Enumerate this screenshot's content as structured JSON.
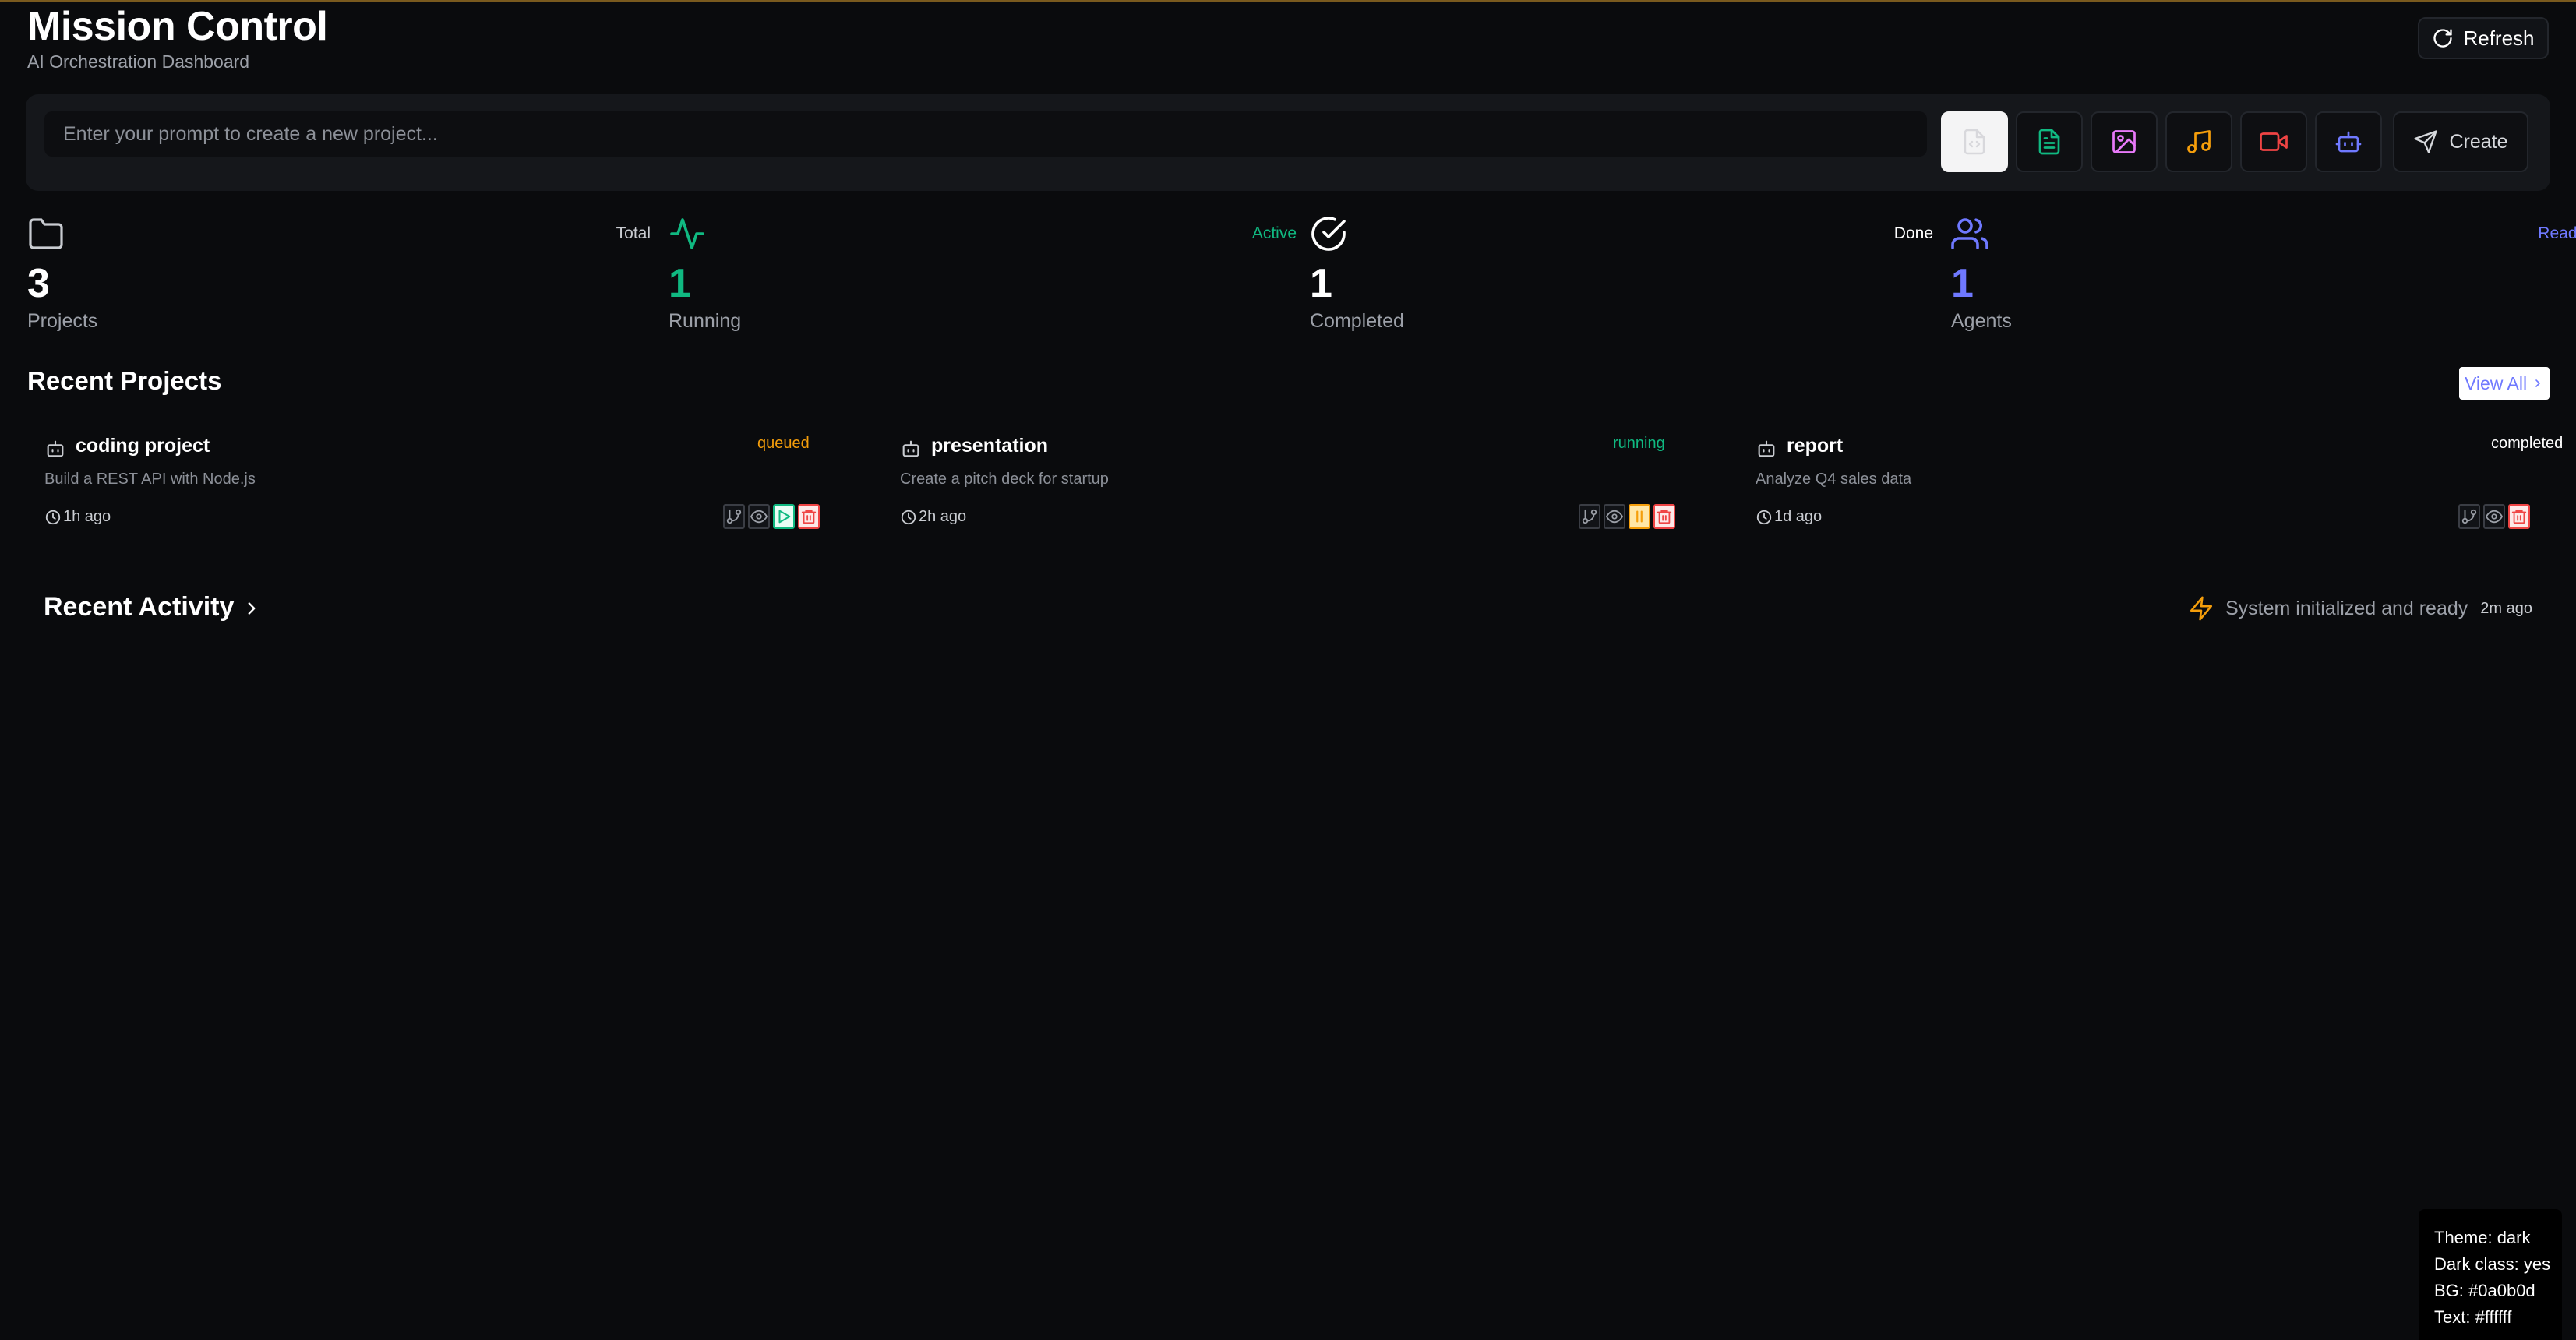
{
  "header": {
    "title": "Mission Control",
    "subtitle": "AI Orchestration Dashboard",
    "refresh_label": "Refresh"
  },
  "prompt": {
    "placeholder": "Enter your prompt to create a new project...",
    "value": "",
    "create_label": "Create",
    "tools": [
      "document",
      "spreadsheet",
      "image",
      "audio",
      "video",
      "agent"
    ],
    "selected_tool": "document"
  },
  "stats": [
    {
      "value": "3",
      "label": "Projects",
      "tag": "Total",
      "icon": "folder-icon",
      "value_color": "#ffffff",
      "tag_color": "#c9ccd1"
    },
    {
      "value": "1",
      "label": "Running",
      "tag": "Active",
      "icon": "activity-icon",
      "value_color": "#10b981",
      "tag_color": "#10b981"
    },
    {
      "value": "1",
      "label": "Completed",
      "tag": "Done",
      "icon": "check-circle-icon",
      "value_color": "#ffffff",
      "tag_color": "#ffffff"
    },
    {
      "value": "1",
      "label": "Agents",
      "tag": "Ready",
      "icon": "users-icon",
      "value_color": "#6f79ff",
      "tag_color": "#6f79ff"
    }
  ],
  "recent_projects": {
    "title": "Recent Projects",
    "view_all_label": "View All",
    "items": [
      {
        "title": "coding project",
        "status": "queued",
        "status_color": "#f59e0b",
        "description": "Build a REST API with Node.js",
        "time": "1h ago",
        "actions": [
          "branch",
          "view",
          "play",
          "delete"
        ]
      },
      {
        "title": "presentation",
        "status": "running",
        "status_color": "#10b981",
        "description": "Create a pitch deck for startup",
        "time": "2h ago",
        "actions": [
          "branch",
          "view",
          "pause",
          "delete"
        ]
      },
      {
        "title": "report",
        "status": "completed",
        "status_color": "#ffffff",
        "description": "Analyze Q4 sales data",
        "time": "1d ago",
        "actions": [
          "branch",
          "view",
          "delete"
        ]
      }
    ]
  },
  "recent_activity": {
    "title": "Recent Activity",
    "latest": {
      "message": "System initialized and ready",
      "time": "2m ago",
      "icon": "zap-icon"
    }
  },
  "debug": {
    "theme": "Theme: dark",
    "dark_class": "Dark class: yes",
    "bg": "BG: #0a0b0d",
    "text": "Text: #ffffff"
  }
}
